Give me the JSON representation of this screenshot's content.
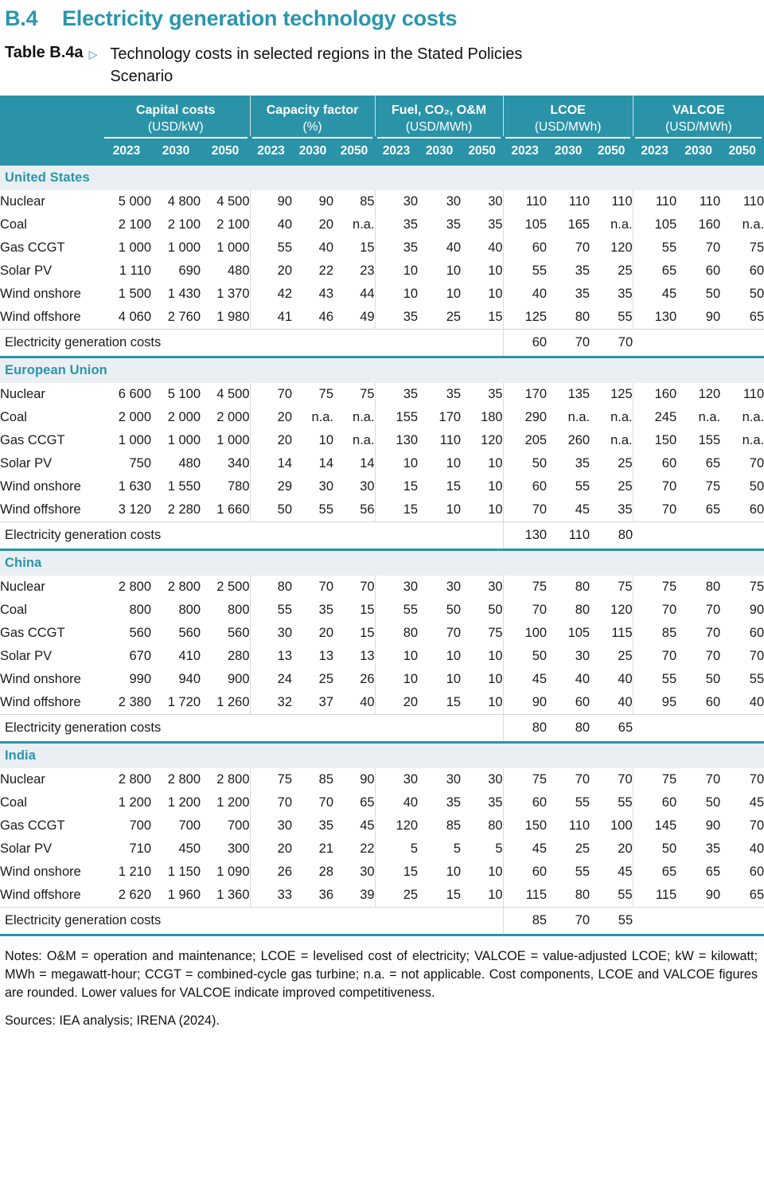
{
  "section": {
    "number": "B.4",
    "title": "Electricity generation technology costs"
  },
  "caption": {
    "label": "Table B.4a",
    "marker": "▷",
    "text": "Technology costs in selected regions in the Stated Policies Scenario"
  },
  "header": {
    "groups": [
      {
        "title": "Capital costs",
        "unit": "(USD/kW)"
      },
      {
        "title": "Capacity factor",
        "unit": "(%)"
      },
      {
        "title": "Fuel, CO₂, O&M",
        "unit": "(USD/MWh)"
      },
      {
        "title": "LCOE",
        "unit": "(USD/MWh)"
      },
      {
        "title": "VALCOE",
        "unit": "(USD/MWh)"
      }
    ],
    "years": [
      "2023",
      "2030",
      "2050"
    ],
    "row_label_blank": ""
  },
  "egc_label": "Electricity generation costs",
  "chart_data": {
    "type": "table",
    "title": "Technology costs in selected regions in the Stated Policies Scenario",
    "column_groups": [
      "Capital costs (USD/kW)",
      "Capacity factor (%)",
      "Fuel, CO2, O&M (USD/MWh)",
      "LCOE (USD/MWh)",
      "VALCOE (USD/MWh)"
    ],
    "years": [
      "2023",
      "2030",
      "2050"
    ],
    "regions": [
      "United States",
      "European Union",
      "China",
      "India"
    ],
    "technologies": [
      "Nuclear",
      "Coal",
      "Gas CCGT",
      "Solar PV",
      "Wind onshore",
      "Wind offshore"
    ]
  },
  "regions": [
    {
      "name": "United States",
      "rows": [
        {
          "tech": "Nuclear",
          "capital": [
            "5 000",
            "4 800",
            "4 500"
          ],
          "cf": [
            "90",
            "90",
            "85"
          ],
          "fuel": [
            "30",
            "30",
            "30"
          ],
          "lcoe": [
            "110",
            "110",
            "110"
          ],
          "valcoe": [
            "110",
            "110",
            "110"
          ]
        },
        {
          "tech": "Coal",
          "capital": [
            "2 100",
            "2 100",
            "2 100"
          ],
          "cf": [
            "40",
            "20",
            "n.a."
          ],
          "fuel": [
            "35",
            "35",
            "35"
          ],
          "lcoe": [
            "105",
            "165",
            "n.a."
          ],
          "valcoe": [
            "105",
            "160",
            "n.a."
          ]
        },
        {
          "tech": "Gas CCGT",
          "capital": [
            "1 000",
            "1 000",
            "1 000"
          ],
          "cf": [
            "55",
            "40",
            "15"
          ],
          "fuel": [
            "35",
            "40",
            "40"
          ],
          "lcoe": [
            "60",
            "70",
            "120"
          ],
          "valcoe": [
            "55",
            "70",
            "75"
          ]
        },
        {
          "tech": "Solar PV",
          "capital": [
            "1 110",
            "690",
            "480"
          ],
          "cf": [
            "20",
            "22",
            "23"
          ],
          "fuel": [
            "10",
            "10",
            "10"
          ],
          "lcoe": [
            "55",
            "35",
            "25"
          ],
          "valcoe": [
            "65",
            "60",
            "60"
          ]
        },
        {
          "tech": "Wind onshore",
          "capital": [
            "1 500",
            "1 430",
            "1 370"
          ],
          "cf": [
            "42",
            "43",
            "44"
          ],
          "fuel": [
            "10",
            "10",
            "10"
          ],
          "lcoe": [
            "40",
            "35",
            "35"
          ],
          "valcoe": [
            "45",
            "50",
            "50"
          ]
        },
        {
          "tech": "Wind offshore",
          "capital": [
            "4 060",
            "2 760",
            "1 980"
          ],
          "cf": [
            "41",
            "46",
            "49"
          ],
          "fuel": [
            "35",
            "25",
            "15"
          ],
          "lcoe": [
            "125",
            "80",
            "55"
          ],
          "valcoe": [
            "130",
            "90",
            "65"
          ]
        }
      ],
      "egc": [
        "60",
        "70",
        "70"
      ]
    },
    {
      "name": "European Union",
      "rows": [
        {
          "tech": "Nuclear",
          "capital": [
            "6 600",
            "5 100",
            "4 500"
          ],
          "cf": [
            "70",
            "75",
            "75"
          ],
          "fuel": [
            "35",
            "35",
            "35"
          ],
          "lcoe": [
            "170",
            "135",
            "125"
          ],
          "valcoe": [
            "160",
            "120",
            "110"
          ]
        },
        {
          "tech": "Coal",
          "capital": [
            "2 000",
            "2 000",
            "2 000"
          ],
          "cf": [
            "20",
            "n.a.",
            "n.a."
          ],
          "fuel": [
            "155",
            "170",
            "180"
          ],
          "lcoe": [
            "290",
            "n.a.",
            "n.a."
          ],
          "valcoe": [
            "245",
            "n.a.",
            "n.a."
          ]
        },
        {
          "tech": "Gas CCGT",
          "capital": [
            "1 000",
            "1 000",
            "1 000"
          ],
          "cf": [
            "20",
            "10",
            "n.a."
          ],
          "fuel": [
            "130",
            "110",
            "120"
          ],
          "lcoe": [
            "205",
            "260",
            "n.a."
          ],
          "valcoe": [
            "150",
            "155",
            "n.a."
          ]
        },
        {
          "tech": "Solar PV",
          "capital": [
            "750",
            "480",
            "340"
          ],
          "cf": [
            "14",
            "14",
            "14"
          ],
          "fuel": [
            "10",
            "10",
            "10"
          ],
          "lcoe": [
            "50",
            "35",
            "25"
          ],
          "valcoe": [
            "60",
            "65",
            "70"
          ]
        },
        {
          "tech": "Wind onshore",
          "capital": [
            "1 630",
            "1 550",
            "780"
          ],
          "cf": [
            "29",
            "30",
            "30"
          ],
          "fuel": [
            "15",
            "15",
            "10"
          ],
          "lcoe": [
            "60",
            "55",
            "25"
          ],
          "valcoe": [
            "70",
            "75",
            "50"
          ]
        },
        {
          "tech": "Wind offshore",
          "capital": [
            "3 120",
            "2 280",
            "1 660"
          ],
          "cf": [
            "50",
            "55",
            "56"
          ],
          "fuel": [
            "15",
            "10",
            "10"
          ],
          "lcoe": [
            "70",
            "45",
            "35"
          ],
          "valcoe": [
            "70",
            "65",
            "60"
          ]
        }
      ],
      "egc": [
        "130",
        "110",
        "80"
      ]
    },
    {
      "name": "China",
      "rows": [
        {
          "tech": "Nuclear",
          "capital": [
            "2 800",
            "2 800",
            "2 500"
          ],
          "cf": [
            "80",
            "70",
            "70"
          ],
          "fuel": [
            "30",
            "30",
            "30"
          ],
          "lcoe": [
            "75",
            "80",
            "75"
          ],
          "valcoe": [
            "75",
            "80",
            "75"
          ]
        },
        {
          "tech": "Coal",
          "capital": [
            "800",
            "800",
            "800"
          ],
          "cf": [
            "55",
            "35",
            "15"
          ],
          "fuel": [
            "55",
            "50",
            "50"
          ],
          "lcoe": [
            "70",
            "80",
            "120"
          ],
          "valcoe": [
            "70",
            "70",
            "90"
          ]
        },
        {
          "tech": "Gas CCGT",
          "capital": [
            "560",
            "560",
            "560"
          ],
          "cf": [
            "30",
            "20",
            "15"
          ],
          "fuel": [
            "80",
            "70",
            "75"
          ],
          "lcoe": [
            "100",
            "105",
            "115"
          ],
          "valcoe": [
            "85",
            "70",
            "60"
          ]
        },
        {
          "tech": "Solar PV",
          "capital": [
            "670",
            "410",
            "280"
          ],
          "cf": [
            "13",
            "13",
            "13"
          ],
          "fuel": [
            "10",
            "10",
            "10"
          ],
          "lcoe": [
            "50",
            "30",
            "25"
          ],
          "valcoe": [
            "70",
            "70",
            "70"
          ]
        },
        {
          "tech": "Wind onshore",
          "capital": [
            "990",
            "940",
            "900"
          ],
          "cf": [
            "24",
            "25",
            "26"
          ],
          "fuel": [
            "10",
            "10",
            "10"
          ],
          "lcoe": [
            "45",
            "40",
            "40"
          ],
          "valcoe": [
            "55",
            "50",
            "55"
          ]
        },
        {
          "tech": "Wind offshore",
          "capital": [
            "2 380",
            "1 720",
            "1 260"
          ],
          "cf": [
            "32",
            "37",
            "40"
          ],
          "fuel": [
            "20",
            "15",
            "10"
          ],
          "lcoe": [
            "90",
            "60",
            "40"
          ],
          "valcoe": [
            "95",
            "60",
            "40"
          ]
        }
      ],
      "egc": [
        "80",
        "80",
        "65"
      ]
    },
    {
      "name": "India",
      "rows": [
        {
          "tech": "Nuclear",
          "capital": [
            "2 800",
            "2 800",
            "2 800"
          ],
          "cf": [
            "75",
            "85",
            "90"
          ],
          "fuel": [
            "30",
            "30",
            "30"
          ],
          "lcoe": [
            "75",
            "70",
            "70"
          ],
          "valcoe": [
            "75",
            "70",
            "70"
          ]
        },
        {
          "tech": "Coal",
          "capital": [
            "1 200",
            "1 200",
            "1 200"
          ],
          "cf": [
            "70",
            "70",
            "65"
          ],
          "fuel": [
            "40",
            "35",
            "35"
          ],
          "lcoe": [
            "60",
            "55",
            "55"
          ],
          "valcoe": [
            "60",
            "50",
            "45"
          ]
        },
        {
          "tech": "Gas CCGT",
          "capital": [
            "700",
            "700",
            "700"
          ],
          "cf": [
            "30",
            "35",
            "45"
          ],
          "fuel": [
            "120",
            "85",
            "80"
          ],
          "lcoe": [
            "150",
            "110",
            "100"
          ],
          "valcoe": [
            "145",
            "90",
            "70"
          ]
        },
        {
          "tech": "Solar PV",
          "capital": [
            "710",
            "450",
            "300"
          ],
          "cf": [
            "20",
            "21",
            "22"
          ],
          "fuel": [
            "5",
            "5",
            "5"
          ],
          "lcoe": [
            "45",
            "25",
            "20"
          ],
          "valcoe": [
            "50",
            "35",
            "40"
          ]
        },
        {
          "tech": "Wind onshore",
          "capital": [
            "1 210",
            "1 150",
            "1 090"
          ],
          "cf": [
            "26",
            "28",
            "30"
          ],
          "fuel": [
            "15",
            "10",
            "10"
          ],
          "lcoe": [
            "60",
            "55",
            "45"
          ],
          "valcoe": [
            "65",
            "65",
            "60"
          ]
        },
        {
          "tech": "Wind offshore",
          "capital": [
            "2 620",
            "1 960",
            "1 360"
          ],
          "cf": [
            "33",
            "36",
            "39"
          ],
          "fuel": [
            "25",
            "15",
            "10"
          ],
          "lcoe": [
            "115",
            "80",
            "55"
          ],
          "valcoe": [
            "115",
            "90",
            "65"
          ]
        }
      ],
      "egc": [
        "85",
        "70",
        "55"
      ]
    }
  ],
  "notes": {
    "body": "Notes:  O&M = operation and maintenance; LCOE = levelised cost of electricity; VALCOE = value-adjusted LCOE; kW = kilowatt; MWh = megawatt-hour; CCGT = combined-cycle gas turbine; n.a. = not applicable. Cost components, LCOE and VALCOE figures are rounded. Lower values for VALCOE indicate improved competitiveness.",
    "sources": "Sources:  IEA analysis; IRENA (2024)."
  },
  "colors": {
    "teal": "#2a93a8",
    "heading": "#2a96ac",
    "region_band": "#e9eff3"
  }
}
